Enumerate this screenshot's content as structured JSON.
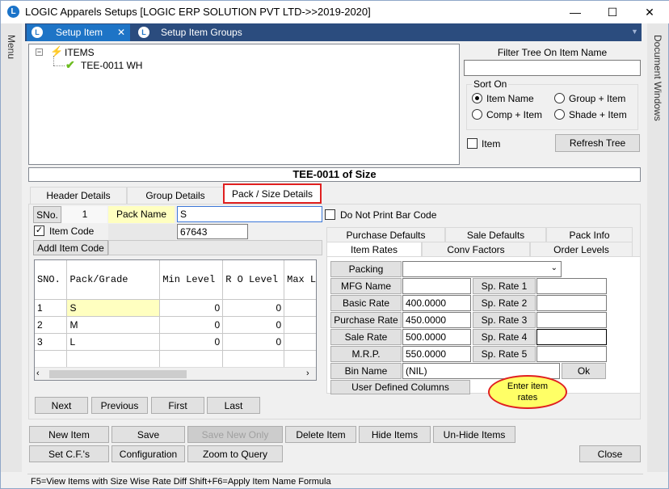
{
  "window": {
    "title": "LOGIC Apparels Setups  [LOGIC ERP SOLUTION PVT LTD->>2019-2020]",
    "icon_letter": "L",
    "min": "—",
    "max": "☐",
    "close": "✕"
  },
  "sidebar": {
    "left": "Menu",
    "right": "Document Windows"
  },
  "tabs": [
    {
      "label": "Setup Item",
      "close": "✕"
    },
    {
      "label": "Setup Item Groups"
    }
  ],
  "tree": {
    "root": "ITEMS",
    "child": "TEE-0011 WH"
  },
  "filter": {
    "label": "Filter Tree On Item Name",
    "value": ""
  },
  "sort_on": {
    "title": "Sort On",
    "options": [
      "Item Name",
      "Group + Item",
      "Comp + Item",
      "Shade + Item"
    ],
    "selected": "Item Name"
  },
  "item_check": "Item",
  "refresh_label": "Refresh Tree",
  "heading": "TEE-0011  of Size",
  "main_tabs": [
    "Header Details",
    "Group Details",
    "Pack / Size Details"
  ],
  "pack": {
    "sno_label": "SNo.",
    "sno_value": "1",
    "packname_label": "Pack Name",
    "packname_value": "S",
    "itemcode_label": "Item Code",
    "itemcode_value": "67643",
    "addl_label": "Addl Item Code",
    "addl_value": ""
  },
  "barcode_label": "Do Not Print Bar Code",
  "grid": {
    "headers": [
      "SNO.",
      "Pack/Grade",
      "Min Level",
      "R O Level",
      "Max Le"
    ],
    "rows": [
      [
        "1",
        "S",
        "0",
        "0"
      ],
      [
        "2",
        "M",
        "0",
        "0"
      ],
      [
        "3",
        "L",
        "0",
        "0"
      ]
    ]
  },
  "nav": [
    "Next",
    "Previous",
    "First",
    "Last"
  ],
  "right_tabs": {
    "row1": [
      "Purchase Defaults",
      "Sale Defaults",
      "Pack Info"
    ],
    "row2": [
      "Item Rates",
      "Conv Factors",
      "Order Levels"
    ]
  },
  "rates": {
    "packing_label": "Packing",
    "packing_value": "",
    "left": [
      {
        "label": "MFG Name",
        "value": ""
      },
      {
        "label": "Basic Rate",
        "value": "400.0000"
      },
      {
        "label": "Purchase Rate",
        "value": "450.0000"
      },
      {
        "label": "Sale Rate",
        "value": "500.0000"
      },
      {
        "label": "M.R.P.",
        "value": "550.0000"
      }
    ],
    "sp": [
      {
        "label": "Sp. Rate 1",
        "value": ""
      },
      {
        "label": "Sp. Rate 2",
        "value": ""
      },
      {
        "label": "Sp. Rate 3",
        "value": ""
      },
      {
        "label": "Sp. Rate 4",
        "value": ""
      },
      {
        "label": "Sp. Rate 5",
        "value": ""
      }
    ],
    "bin_label": "Bin Name",
    "bin_value": "(NIL)",
    "ok": "Ok",
    "udc": "User Defined Columns"
  },
  "callout": "Enter  item rates",
  "bottom_row1": [
    "New Item",
    "Save",
    "Save New Only",
    "Delete Item",
    "Hide Items",
    "Un-Hide Items"
  ],
  "bottom_row2": [
    "Set C.F.'s",
    "Configuration",
    "Zoom to Query"
  ],
  "close_label": "Close",
  "status": "F5=View Items with Size Wise Rate Diff   Shift+F6=Apply Item Name Formula",
  "colors": {
    "tab_active": "#1e74c6",
    "tab_strip": "#2b4c7e",
    "highlight": "#ffffc0",
    "callout": "#ffff66",
    "accent_red": "#e02020"
  }
}
